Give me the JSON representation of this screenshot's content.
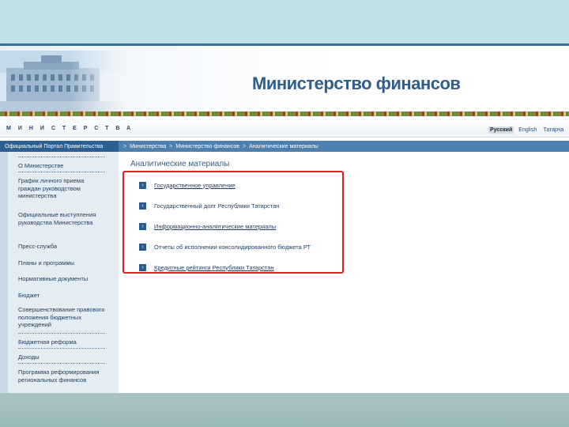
{
  "header": {
    "title": "Министерство финансов",
    "nav_letters": "МИНИСТЕРСТВА",
    "languages": [
      {
        "label": "Русский",
        "active": true
      },
      {
        "label": "English",
        "active": false
      },
      {
        "label": "Татарча",
        "active": false
      }
    ]
  },
  "breadcrumb": {
    "portal": "Официальный Портал Правительства",
    "items": [
      "Министерства",
      "Министерство финансов",
      "Аналитические материалы"
    ],
    "separator": ">"
  },
  "sidebar": {
    "items": [
      "О Министерстве",
      "График личного приема граждан руководством министерства",
      "Официальные выступления руководства Министерства",
      "Пресс-служба",
      "Планы и программы",
      "Нормативные документы",
      "Бюджет",
      "Совершенствование правового положения бюджетных учреждений",
      "Бюджетная реформа",
      "Доходы",
      "Программа реформирования региональных финансов"
    ]
  },
  "main": {
    "title": "Аналитические материалы",
    "arrow": "›",
    "links": [
      "Государственное управление",
      "Государственный долг Республики Татарстан",
      "Информационно-аналитические материалы",
      "Отчеты об исполнении консолидированного бюджета РТ",
      "Кредитные рейтинги Республики Татарстан"
    ]
  },
  "colors": {
    "brand": "#2f5e8c",
    "highlight": "#e02020",
    "sidebar": "#e4ecf4"
  }
}
